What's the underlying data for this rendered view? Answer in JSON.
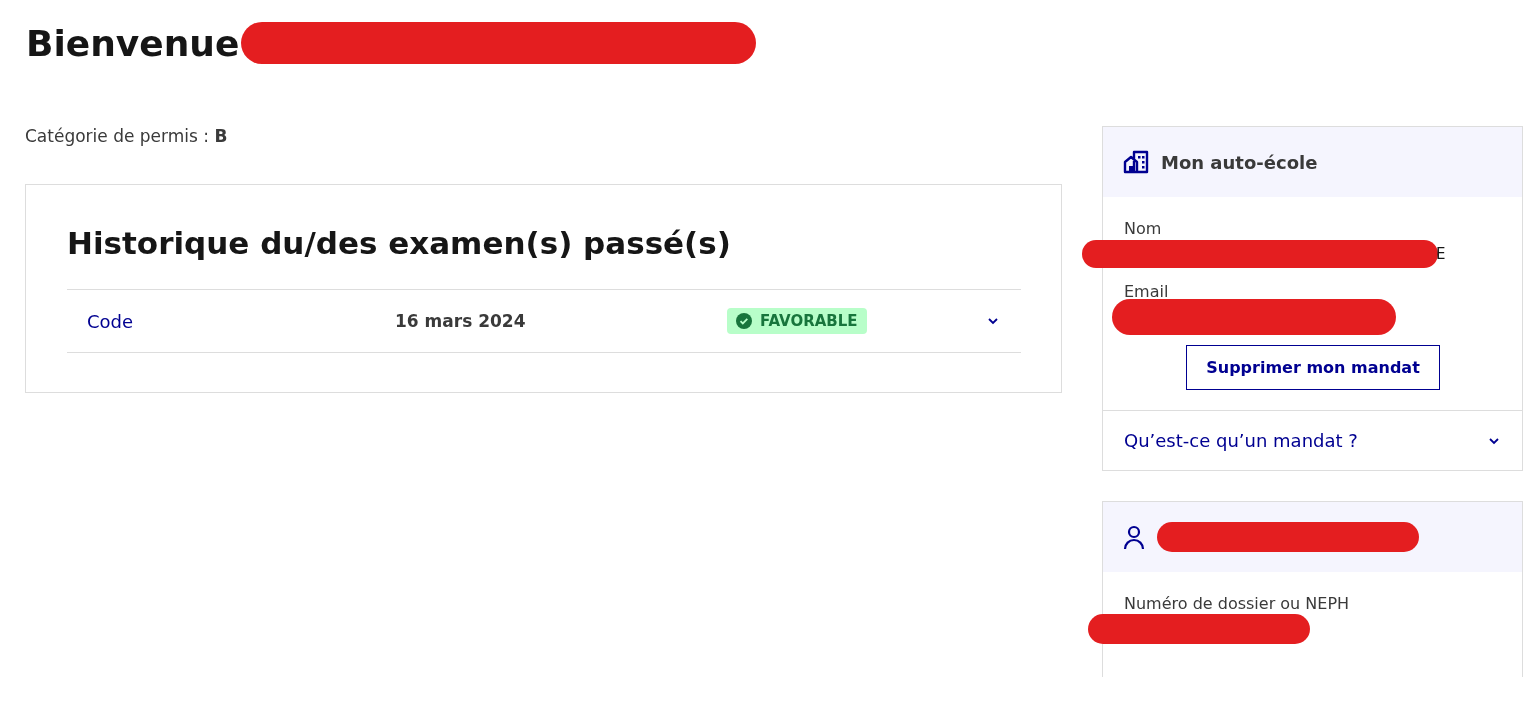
{
  "greeting": {
    "text": "Bienvenue",
    "redacted": true
  },
  "license": {
    "label": "Catégorie de permis : ",
    "value": "B"
  },
  "history": {
    "title": "Historique du/des examen(s) passé(s)",
    "rows": [
      {
        "exam": "Code",
        "date": "16 mars 2024",
        "result": "FAVORABLE",
        "expanded": false
      }
    ]
  },
  "driving_school": {
    "title": "Mon auto-école",
    "fields": [
      {
        "label": "Nom",
        "redacted": true,
        "visible_tail": "E"
      },
      {
        "label": "Email",
        "redacted": true
      }
    ],
    "button": "Supprimer mon mandat",
    "accordion": {
      "label": "Qu’est-ce qu’un mandat ?",
      "expanded": false
    }
  },
  "candidate": {
    "title_redacted": true,
    "fields": [
      {
        "label": "Numéro de dossier ou NEPH",
        "redacted": true
      }
    ]
  }
}
